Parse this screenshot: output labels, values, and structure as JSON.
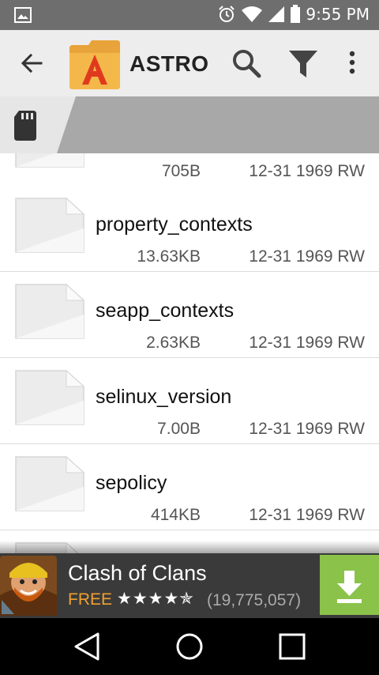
{
  "status_bar": {
    "time": "9:55 PM",
    "icons": [
      "image-icon",
      "alarm-icon",
      "wifi-icon",
      "signal-icon",
      "battery-icon"
    ]
  },
  "app_bar": {
    "title": "ASTRO",
    "icons": [
      "back-arrow-icon",
      "astro-logo",
      "search-icon",
      "filter-icon",
      "more-vert-icon"
    ]
  },
  "path_bar": {
    "icon": "sd-card-icon"
  },
  "files": [
    {
      "name": "",
      "size": "705B",
      "date": "12-31 1969 RW"
    },
    {
      "name": "property_contexts",
      "size": "13.63KB",
      "date": "12-31 1969 RW"
    },
    {
      "name": "seapp_contexts",
      "size": "2.63KB",
      "date": "12-31 1969 RW"
    },
    {
      "name": "selinux_version",
      "size": "7.00B",
      "date": "12-31 1969 RW"
    },
    {
      "name": "sepolicy",
      "size": "414KB",
      "date": "12-31 1969 RW"
    }
  ],
  "ad": {
    "title": "Clash of Clans",
    "price": "FREE",
    "stars": "★★★★✯",
    "rating": 4.5,
    "reviews": "(19,775,057)",
    "accent_color": "#8bc34a"
  },
  "nav_bar": {
    "icons": [
      "nav-back-icon",
      "nav-home-icon",
      "nav-recents-icon"
    ]
  }
}
